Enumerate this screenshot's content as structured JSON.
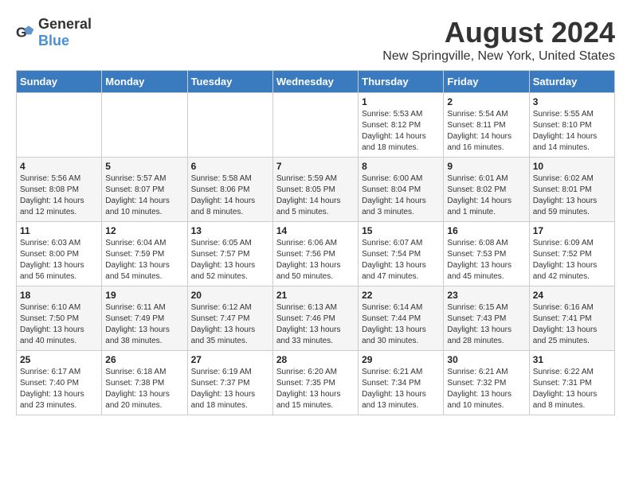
{
  "logo": {
    "general": "General",
    "blue": "Blue"
  },
  "title": {
    "month_year": "August 2024",
    "location": "New Springville, New York, United States"
  },
  "weekdays": [
    "Sunday",
    "Monday",
    "Tuesday",
    "Wednesday",
    "Thursday",
    "Friday",
    "Saturday"
  ],
  "weeks": [
    [
      {
        "date": "",
        "sunrise": "",
        "sunset": "",
        "daylight": ""
      },
      {
        "date": "",
        "sunrise": "",
        "sunset": "",
        "daylight": ""
      },
      {
        "date": "",
        "sunrise": "",
        "sunset": "",
        "daylight": ""
      },
      {
        "date": "",
        "sunrise": "",
        "sunset": "",
        "daylight": ""
      },
      {
        "date": "1",
        "sunrise": "Sunrise: 5:53 AM",
        "sunset": "Sunset: 8:12 PM",
        "daylight": "Daylight: 14 hours and 18 minutes."
      },
      {
        "date": "2",
        "sunrise": "Sunrise: 5:54 AM",
        "sunset": "Sunset: 8:11 PM",
        "daylight": "Daylight: 14 hours and 16 minutes."
      },
      {
        "date": "3",
        "sunrise": "Sunrise: 5:55 AM",
        "sunset": "Sunset: 8:10 PM",
        "daylight": "Daylight: 14 hours and 14 minutes."
      }
    ],
    [
      {
        "date": "4",
        "sunrise": "Sunrise: 5:56 AM",
        "sunset": "Sunset: 8:08 PM",
        "daylight": "Daylight: 14 hours and 12 minutes."
      },
      {
        "date": "5",
        "sunrise": "Sunrise: 5:57 AM",
        "sunset": "Sunset: 8:07 PM",
        "daylight": "Daylight: 14 hours and 10 minutes."
      },
      {
        "date": "6",
        "sunrise": "Sunrise: 5:58 AM",
        "sunset": "Sunset: 8:06 PM",
        "daylight": "Daylight: 14 hours and 8 minutes."
      },
      {
        "date": "7",
        "sunrise": "Sunrise: 5:59 AM",
        "sunset": "Sunset: 8:05 PM",
        "daylight": "Daylight: 14 hours and 5 minutes."
      },
      {
        "date": "8",
        "sunrise": "Sunrise: 6:00 AM",
        "sunset": "Sunset: 8:04 PM",
        "daylight": "Daylight: 14 hours and 3 minutes."
      },
      {
        "date": "9",
        "sunrise": "Sunrise: 6:01 AM",
        "sunset": "Sunset: 8:02 PM",
        "daylight": "Daylight: 14 hours and 1 minute."
      },
      {
        "date": "10",
        "sunrise": "Sunrise: 6:02 AM",
        "sunset": "Sunset: 8:01 PM",
        "daylight": "Daylight: 13 hours and 59 minutes."
      }
    ],
    [
      {
        "date": "11",
        "sunrise": "Sunrise: 6:03 AM",
        "sunset": "Sunset: 8:00 PM",
        "daylight": "Daylight: 13 hours and 56 minutes."
      },
      {
        "date": "12",
        "sunrise": "Sunrise: 6:04 AM",
        "sunset": "Sunset: 7:59 PM",
        "daylight": "Daylight: 13 hours and 54 minutes."
      },
      {
        "date": "13",
        "sunrise": "Sunrise: 6:05 AM",
        "sunset": "Sunset: 7:57 PM",
        "daylight": "Daylight: 13 hours and 52 minutes."
      },
      {
        "date": "14",
        "sunrise": "Sunrise: 6:06 AM",
        "sunset": "Sunset: 7:56 PM",
        "daylight": "Daylight: 13 hours and 50 minutes."
      },
      {
        "date": "15",
        "sunrise": "Sunrise: 6:07 AM",
        "sunset": "Sunset: 7:54 PM",
        "daylight": "Daylight: 13 hours and 47 minutes."
      },
      {
        "date": "16",
        "sunrise": "Sunrise: 6:08 AM",
        "sunset": "Sunset: 7:53 PM",
        "daylight": "Daylight: 13 hours and 45 minutes."
      },
      {
        "date": "17",
        "sunrise": "Sunrise: 6:09 AM",
        "sunset": "Sunset: 7:52 PM",
        "daylight": "Daylight: 13 hours and 42 minutes."
      }
    ],
    [
      {
        "date": "18",
        "sunrise": "Sunrise: 6:10 AM",
        "sunset": "Sunset: 7:50 PM",
        "daylight": "Daylight: 13 hours and 40 minutes."
      },
      {
        "date": "19",
        "sunrise": "Sunrise: 6:11 AM",
        "sunset": "Sunset: 7:49 PM",
        "daylight": "Daylight: 13 hours and 38 minutes."
      },
      {
        "date": "20",
        "sunrise": "Sunrise: 6:12 AM",
        "sunset": "Sunset: 7:47 PM",
        "daylight": "Daylight: 13 hours and 35 minutes."
      },
      {
        "date": "21",
        "sunrise": "Sunrise: 6:13 AM",
        "sunset": "Sunset: 7:46 PM",
        "daylight": "Daylight: 13 hours and 33 minutes."
      },
      {
        "date": "22",
        "sunrise": "Sunrise: 6:14 AM",
        "sunset": "Sunset: 7:44 PM",
        "daylight": "Daylight: 13 hours and 30 minutes."
      },
      {
        "date": "23",
        "sunrise": "Sunrise: 6:15 AM",
        "sunset": "Sunset: 7:43 PM",
        "daylight": "Daylight: 13 hours and 28 minutes."
      },
      {
        "date": "24",
        "sunrise": "Sunrise: 6:16 AM",
        "sunset": "Sunset: 7:41 PM",
        "daylight": "Daylight: 13 hours and 25 minutes."
      }
    ],
    [
      {
        "date": "25",
        "sunrise": "Sunrise: 6:17 AM",
        "sunset": "Sunset: 7:40 PM",
        "daylight": "Daylight: 13 hours and 23 minutes."
      },
      {
        "date": "26",
        "sunrise": "Sunrise: 6:18 AM",
        "sunset": "Sunset: 7:38 PM",
        "daylight": "Daylight: 13 hours and 20 minutes."
      },
      {
        "date": "27",
        "sunrise": "Sunrise: 6:19 AM",
        "sunset": "Sunset: 7:37 PM",
        "daylight": "Daylight: 13 hours and 18 minutes."
      },
      {
        "date": "28",
        "sunrise": "Sunrise: 6:20 AM",
        "sunset": "Sunset: 7:35 PM",
        "daylight": "Daylight: 13 hours and 15 minutes."
      },
      {
        "date": "29",
        "sunrise": "Sunrise: 6:21 AM",
        "sunset": "Sunset: 7:34 PM",
        "daylight": "Daylight: 13 hours and 13 minutes."
      },
      {
        "date": "30",
        "sunrise": "Sunrise: 6:21 AM",
        "sunset": "Sunset: 7:32 PM",
        "daylight": "Daylight: 13 hours and 10 minutes."
      },
      {
        "date": "31",
        "sunrise": "Sunrise: 6:22 AM",
        "sunset": "Sunset: 7:31 PM",
        "daylight": "Daylight: 13 hours and 8 minutes."
      }
    ]
  ]
}
